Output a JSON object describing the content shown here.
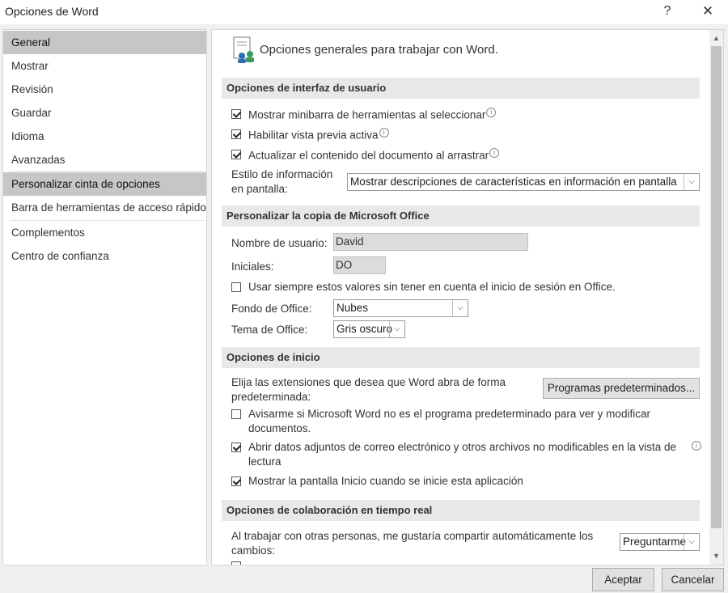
{
  "window": {
    "title": "Opciones de Word",
    "help": "?",
    "close": "✕"
  },
  "sidebar": {
    "items": [
      {
        "label": "General"
      },
      {
        "label": "Mostrar"
      },
      {
        "label": "Revisión"
      },
      {
        "label": "Guardar"
      },
      {
        "label": "Idioma"
      },
      {
        "label": "Avanzadas"
      },
      {
        "label": "Personalizar cinta de opciones"
      },
      {
        "label": "Barra de herramientas de acceso rápido"
      },
      {
        "label": "Complementos"
      },
      {
        "label": "Centro de confianza"
      }
    ]
  },
  "main": {
    "header": "Opciones generales para trabajar con Word.",
    "ui_options": {
      "title": "Opciones de interfaz de usuario",
      "minibar": "Mostrar minibarra de herramientas al seleccionar",
      "live_preview": "Habilitar vista previa activa",
      "update_drag": "Actualizar el contenido del documento al arrastrar",
      "screentip_label_1": "Estilo de información",
      "screentip_label_2": "en pantalla:",
      "screentip_value": "Mostrar descripciones de características en información en pantalla"
    },
    "personalize": {
      "title": "Personalizar la copia de Microsoft Office",
      "username_label": "Nombre de usuario:",
      "username": "David",
      "initials_label": "Iniciales:",
      "initials": "DO",
      "always_use": "Usar siempre estos valores sin tener en cuenta el inicio de sesión en Office.",
      "background_label": "Fondo de Office:",
      "background": "Nubes",
      "theme_label": "Tema de Office:",
      "theme": "Gris oscuro"
    },
    "startup": {
      "title": "Opciones de inicio",
      "extensions_1": "Elija las extensiones que desea que Word abra de forma",
      "extensions_2": "predeterminada:",
      "default_programs": "Programas predeterminados...",
      "notify_1": "Avisarme si Microsoft Word no es el programa predeterminado para ver y modificar",
      "notify_2": "documentos.",
      "open_attachments_1": "Abrir datos adjuntos de correo electrónico y otros archivos no modificables en la vista de",
      "open_attachments_2": "lectura",
      "show_start": "Mostrar la pantalla Inicio cuando se inicie esta aplicación"
    },
    "collab": {
      "title": "Opciones de colaboración en tiempo real",
      "share_1": "Al trabajar con otras personas, me gustaría compartir automáticamente los",
      "share_2": "cambios:",
      "share_value": "Preguntarme"
    }
  },
  "footer": {
    "accept": "Aceptar",
    "cancel": "Cancelar"
  }
}
